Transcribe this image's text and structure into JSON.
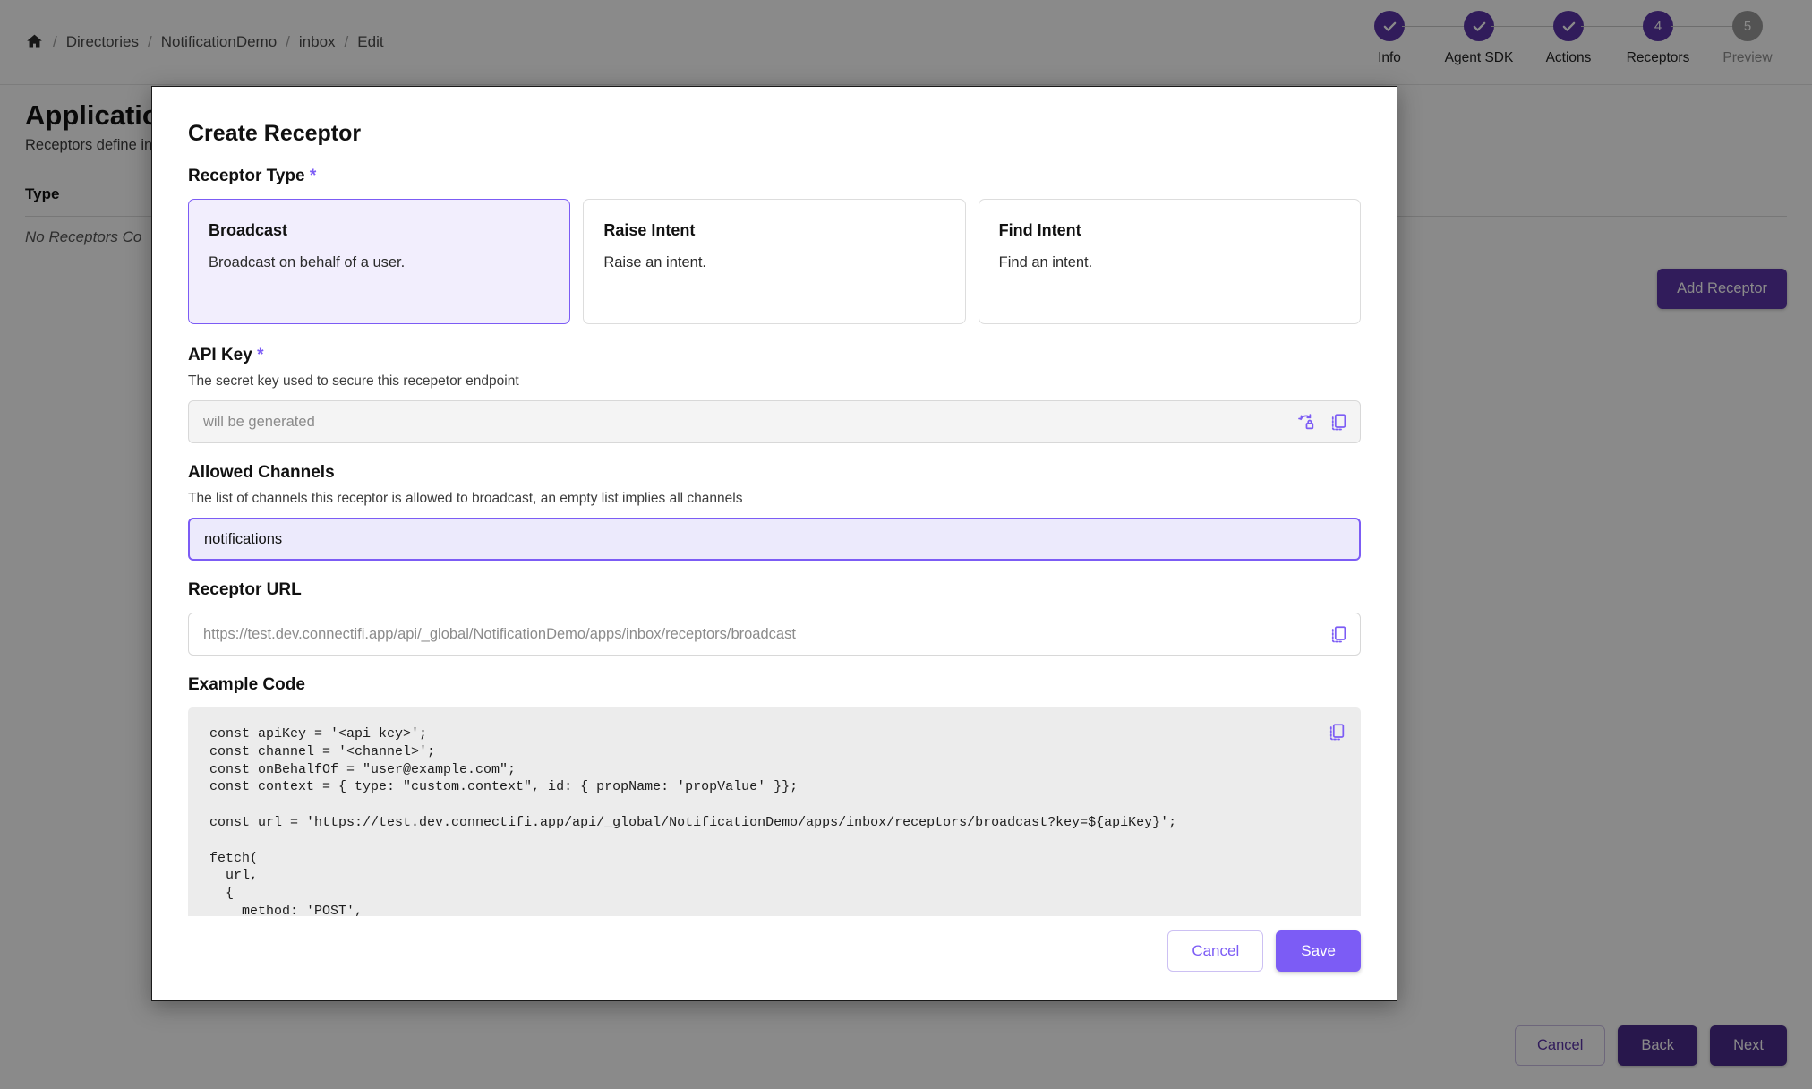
{
  "breadcrumb": {
    "home_icon": "home-icon",
    "items": [
      "Directories",
      "NotificationDemo",
      "inbox",
      "Edit"
    ],
    "separator": "/"
  },
  "stepper": {
    "steps": [
      {
        "label": "Info",
        "marker": "✓",
        "state": "done"
      },
      {
        "label": "Agent SDK",
        "marker": "✓",
        "state": "done"
      },
      {
        "label": "Actions",
        "marker": "✓",
        "state": "done"
      },
      {
        "label": "Receptors",
        "marker": "4",
        "state": "active"
      },
      {
        "label": "Preview",
        "marker": "5",
        "state": "inactive"
      }
    ]
  },
  "background_page": {
    "title": "Application",
    "subtitle": "Receptors define inco",
    "table": {
      "columns": [
        "Type"
      ],
      "empty_message": "No Receptors Co"
    },
    "add_receptor_label": "Add Receptor",
    "footer_buttons": [
      "Cancel",
      "Back",
      "Next"
    ]
  },
  "modal": {
    "title": "Create Receptor",
    "receptor_type": {
      "label": "Receptor Type",
      "required_marker": "*",
      "options": [
        {
          "title": "Broadcast",
          "description": "Broadcast on behalf of a user.",
          "selected": true
        },
        {
          "title": "Raise Intent",
          "description": "Raise an intent.",
          "selected": false
        },
        {
          "title": "Find Intent",
          "description": "Find an intent.",
          "selected": false
        }
      ]
    },
    "api_key": {
      "label": "API Key",
      "required_marker": "*",
      "help": "The secret key used to secure this recepetor endpoint",
      "placeholder": "will be generated",
      "value": "",
      "icons": [
        "regenerate-key-icon",
        "copy-icon"
      ]
    },
    "allowed_channels": {
      "label": "Allowed Channels",
      "help": "The list of channels this receptor is allowed to broadcast, an empty list implies all channels",
      "value": "notifications",
      "placeholder": "",
      "focused": true
    },
    "receptor_url": {
      "label": "Receptor URL",
      "placeholder": "https://test.dev.connectifi.app/api/_global/NotificationDemo/apps/inbox/receptors/broadcast",
      "value": "",
      "icons": [
        "copy-icon"
      ]
    },
    "example_code": {
      "label": "Example Code",
      "copy_icon": "copy-icon",
      "code": "const apiKey = '<api key>';\nconst channel = '<channel>';\nconst onBehalfOf = \"user@example.com\";\nconst context = { type: \"custom.context\", id: { propName: 'propValue' }};\n\nconst url = 'https://test.dev.connectifi.app/api/_global/NotificationDemo/apps/inbox/receptors/broadcast?key=${apiKey}';\n\nfetch(\n  url,\n  {\n    method: 'POST',"
    },
    "footer": {
      "cancel_label": "Cancel",
      "save_label": "Save"
    }
  },
  "colors": {
    "accent_purple": "#7c5cf5",
    "deep_purple": "#5b34a8",
    "selected_card_bg": "#f2eefd",
    "focused_input_bg": "#eceafc",
    "code_bg": "#ececec"
  }
}
